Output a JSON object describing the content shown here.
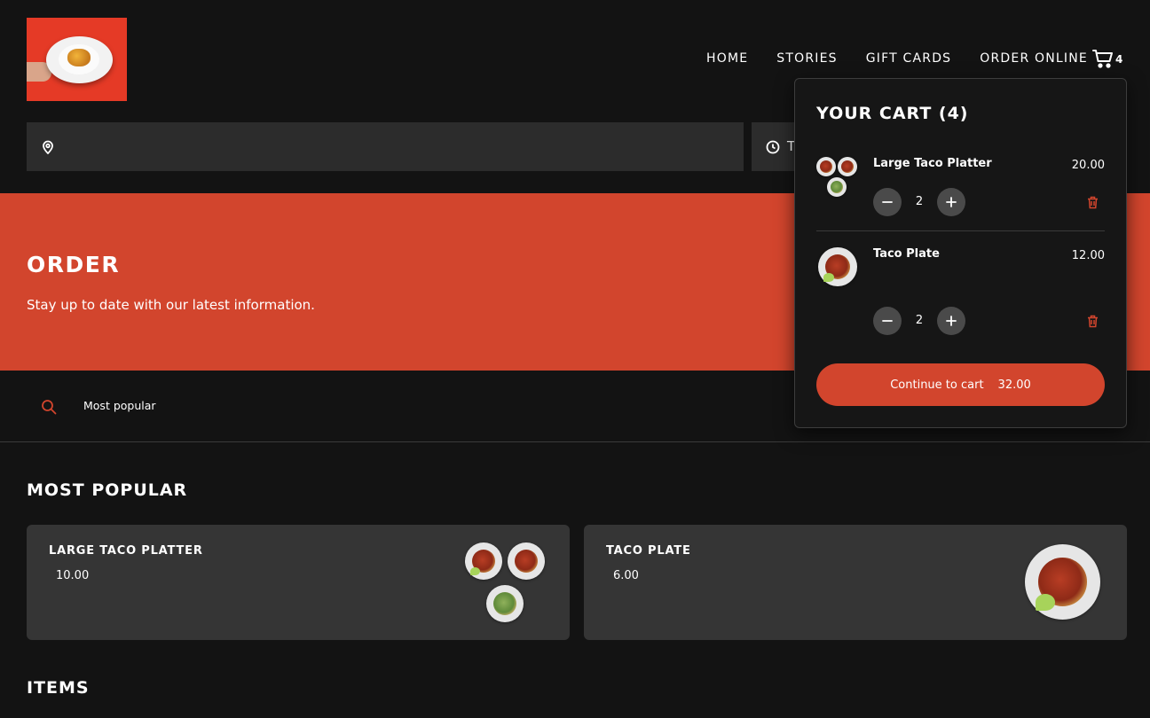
{
  "nav": {
    "items": [
      "HOME",
      "STORIES",
      "GIFT CARDS",
      "ORDER ONLINE"
    ],
    "cart_count": "4"
  },
  "time_selector": {
    "value": "T"
  },
  "hero": {
    "title": "ORDER",
    "subtitle": "Stay up to date with our latest information."
  },
  "filter": {
    "chip": "Most popular"
  },
  "sections": {
    "most_popular": "MOST POPULAR",
    "items": "ITEMS"
  },
  "cards": [
    {
      "name": "LARGE TACO PLATTER",
      "price": "10.00"
    },
    {
      "name": "TACO PLATE",
      "price": "6.00"
    }
  ],
  "cart": {
    "title": "YOUR CART (4)",
    "items": [
      {
        "name": "Large Taco Platter",
        "price": "20.00",
        "qty": "2"
      },
      {
        "name": "Taco Plate",
        "price": "12.00",
        "qty": "2"
      }
    ],
    "checkout_label": "Continue to cart",
    "checkout_total": "32.00"
  },
  "colors": {
    "accent": "#d2452d",
    "background": "#131313",
    "card": "#353535",
    "logo_bg": "#e53a26"
  },
  "icons": [
    "location-icon",
    "clock-icon",
    "search-icon",
    "cart-icon",
    "minus-icon",
    "plus-icon",
    "trash-icon"
  ]
}
